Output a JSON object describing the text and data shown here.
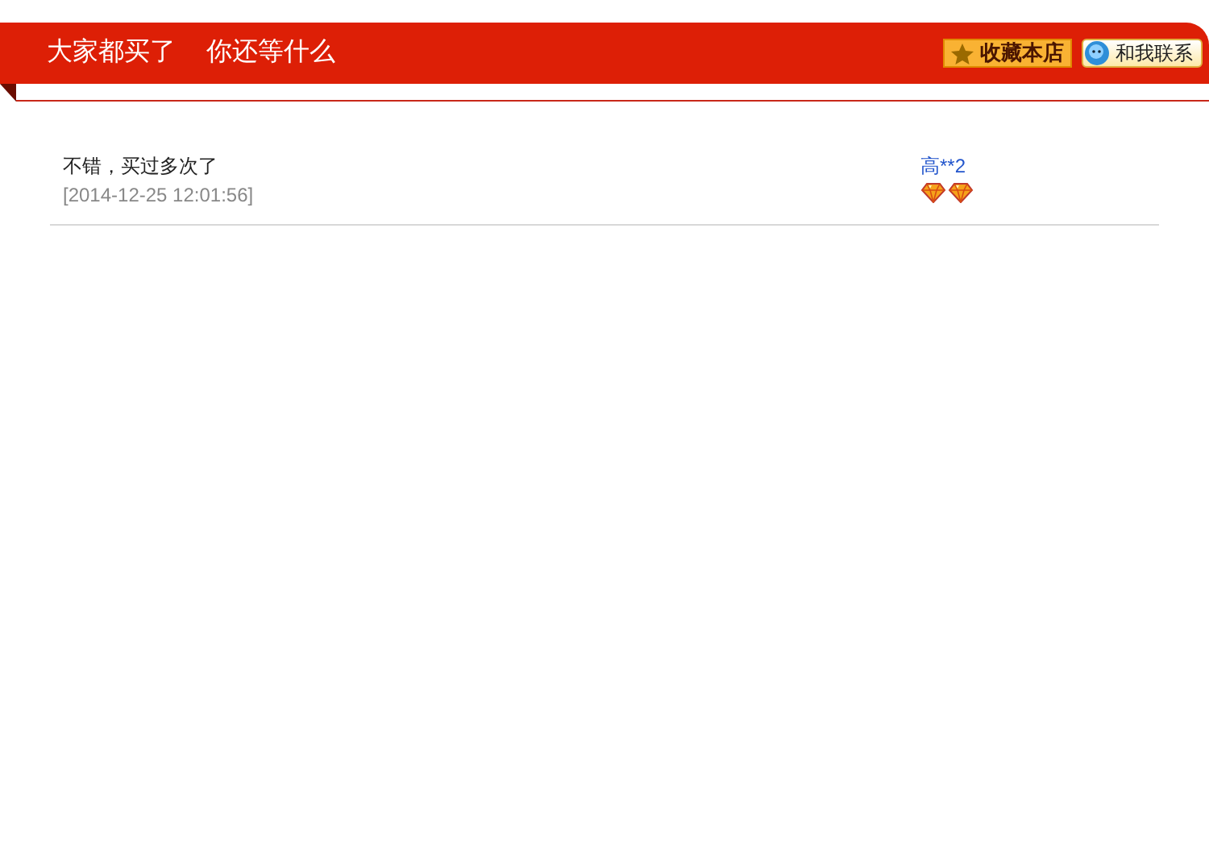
{
  "header": {
    "titles": [
      "大家都买了",
      "你还等什么"
    ],
    "buttons": [
      {
        "kind": "favorite",
        "label": "收藏本店"
      },
      {
        "kind": "contact",
        "label": "和我联系"
      }
    ]
  },
  "reviews": [
    {
      "comment": "不错，买过多次了",
      "time": "[2014-12-25 12:01:56]",
      "user": "高**2"
    }
  ]
}
